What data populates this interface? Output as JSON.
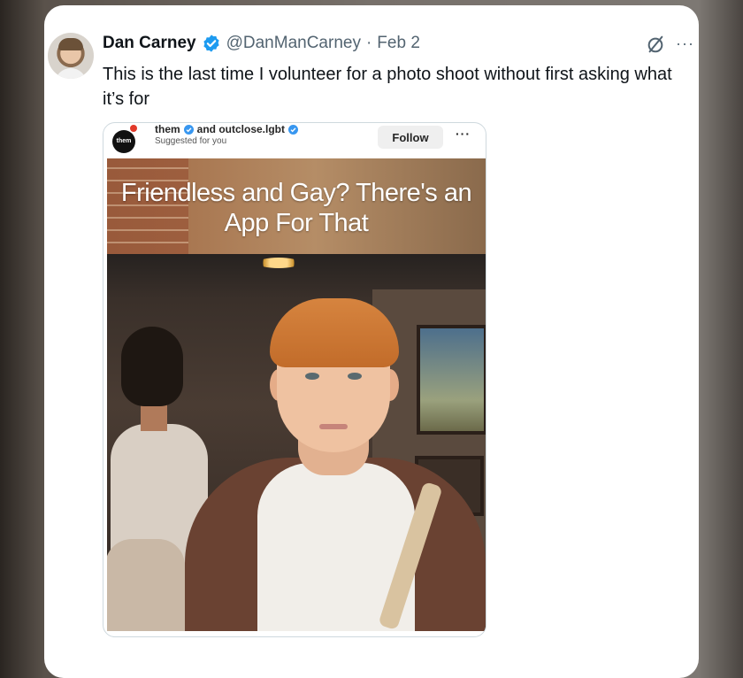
{
  "tweet": {
    "author_name": "Dan Carney",
    "handle": "@DanManCarney",
    "separator": "·",
    "date": "Feb 2",
    "text": "This is the last time I volunteer for a photo shoot without first asking what it’s for",
    "more_icon_glyph": "···"
  },
  "embed": {
    "logo_text": "them",
    "accounts": [
      "them",
      "and outclose.lgbt"
    ],
    "suggested": "Suggested for you",
    "follow_label": "Follow",
    "more_glyph": "···",
    "headline": "Friendless and Gay? There's an App For That"
  },
  "colors": {
    "verified": "#1d9bf0",
    "text_primary": "#0f1419",
    "text_secondary": "#536471"
  },
  "icons": [
    "verified-badge-icon",
    "grok-icon",
    "more-options-icon"
  ]
}
